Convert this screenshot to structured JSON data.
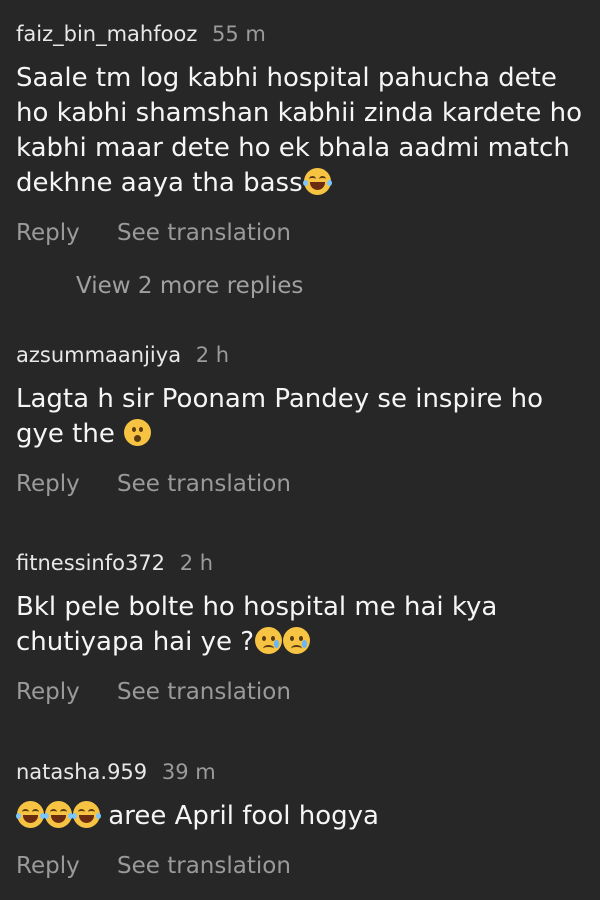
{
  "comments": [
    {
      "username": "faiz_bin_mahfooz",
      "time": "55 m",
      "text": "Saale tm log kabhi hospital pahucha dete ho kabhi shamshan kabhii zinda kardete ho kabhi maar dete ho ek bhala aadmi match dekhne aaya tha bass",
      "emojis": [
        "face-with-tears-of-joy"
      ],
      "reply_label": "Reply",
      "translation_label": "See translation",
      "view_more_label": "View 2 more replies"
    },
    {
      "username": "azsummaanjiya",
      "time": "2 h",
      "text": "Lagta h sir Poonam Pandey se inspire ho gye the",
      "emojis": [
        "hushed-face"
      ],
      "reply_label": "Reply",
      "translation_label": "See translation"
    },
    {
      "username": "fitnessinfo372",
      "time": "2 h",
      "text": "Bkl pele bolte ho hospital me hai kya chutiyapa hai ye ?",
      "emojis": [
        "crying-face",
        "crying-face"
      ],
      "reply_label": "Reply",
      "translation_label": "See translation"
    },
    {
      "username": "natasha.959",
      "time": "39 m",
      "text": "aree April fool hogya",
      "emojis": [
        "face-with-tears-of-joy",
        "face-with-tears-of-joy",
        "face-with-tears-of-joy"
      ],
      "reply_label": "Reply",
      "translation_label": "See translation"
    }
  ],
  "colors": {
    "background": "#272727",
    "primary_text": "#f5f5f5",
    "secondary_text": "#9b9b9b",
    "emoji_yellow": "#f6c343"
  }
}
